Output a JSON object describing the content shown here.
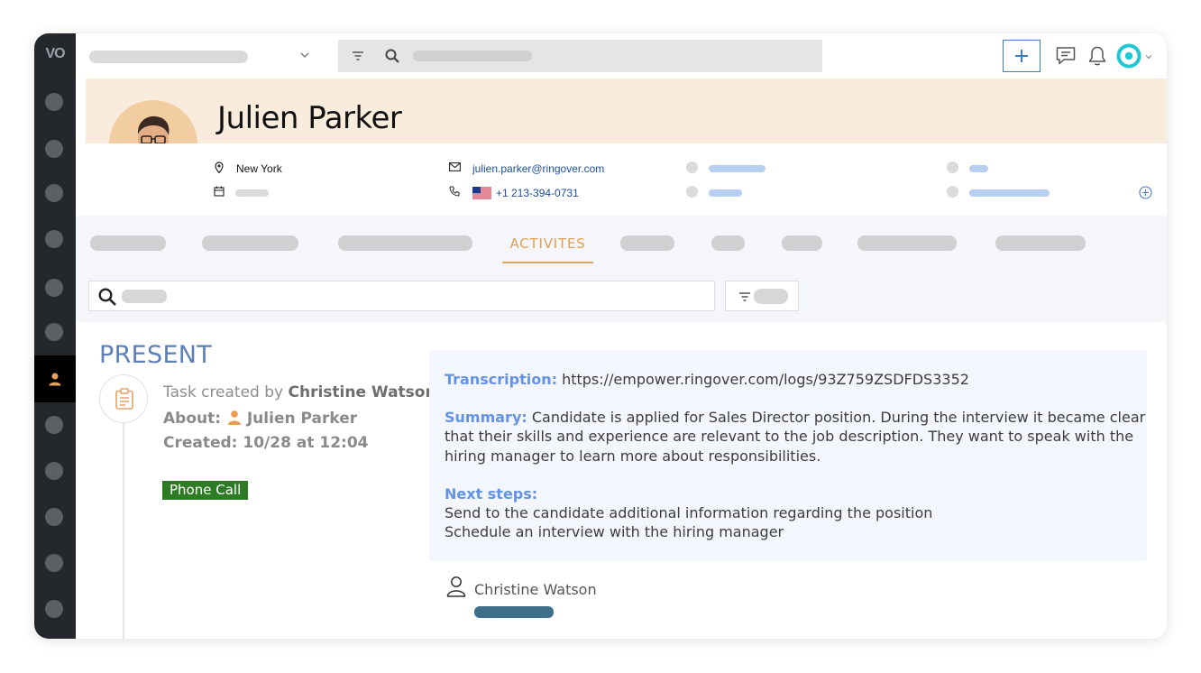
{
  "app": {
    "logo_text": "VO"
  },
  "contact": {
    "name": "Julien Parker",
    "city": "New York",
    "email": "julien.parker@ringover.com",
    "phone": "+1 213-394-0731"
  },
  "tabs": {
    "active_label": "ACTIVITES"
  },
  "feed": {
    "section_title": "PRESENT",
    "task": {
      "created_by_prefix": "Task created by",
      "created_by_name": "Christine Watson",
      "about_label": "About:",
      "about_name": "Julien Parker",
      "created_label": "Created: 10/28 at 12:04",
      "badge": "Phone Call"
    },
    "note": {
      "transcription_label": "Transcription:",
      "transcription_url": "https://empower.ringover.com/logs/93Z759ZSDFDS3352",
      "summary_label": "Summary:",
      "summary_line1": "Candidate is applied for Sales Director position. During the interview it became clear",
      "summary_line2": "that their skills and experience are relevant to the job description. They want to speak with the",
      "summary_line3": "hiring manager to learn more about responsibilities.",
      "next_steps_label": "Next steps:",
      "next_step1": "Send to the candidate additional information regarding the position",
      "next_step2": "Schedule an interview with the hiring manager"
    },
    "author": "Christine Watson"
  },
  "colors": {
    "accent_orange": "#e19f57",
    "header_band": "#f9ecdd",
    "label_blue": "#6493e6",
    "badge_green": "#2f7a25",
    "sidebar": "#24272b"
  }
}
